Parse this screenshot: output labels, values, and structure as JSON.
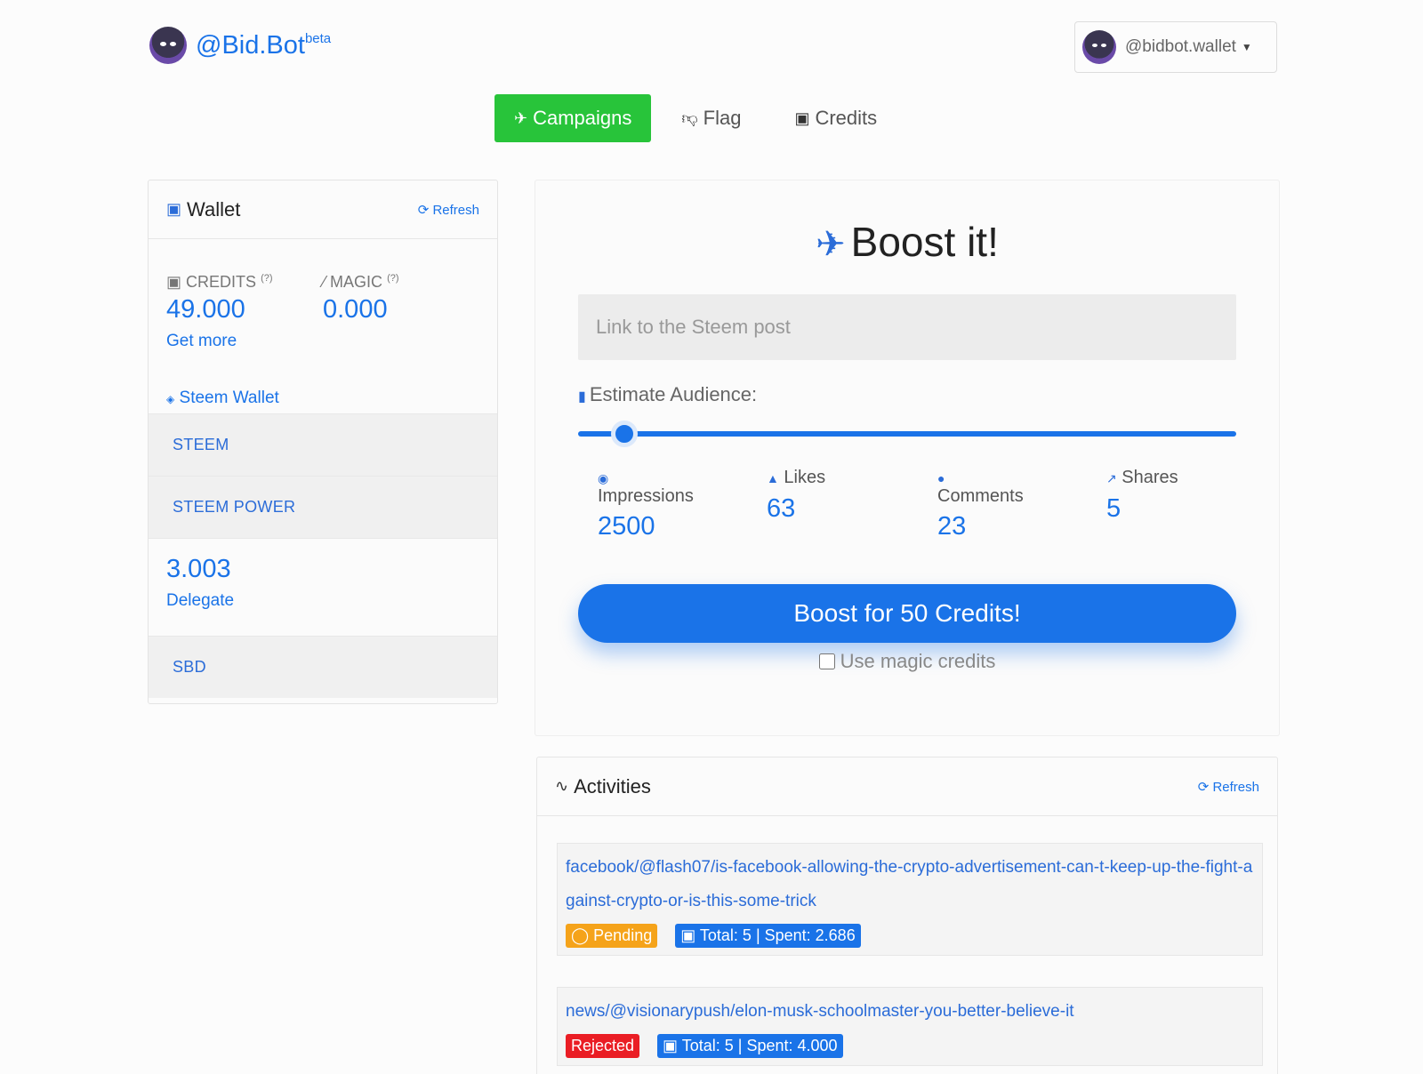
{
  "header": {
    "brand": "@Bid.Bot",
    "brand_sup": "beta",
    "user": "@bidbot.wallet"
  },
  "nav": {
    "campaigns": "Campaigns",
    "flag": "Flag",
    "credits": "Credits"
  },
  "wallet": {
    "title": "Wallet",
    "refresh": "Refresh",
    "credits_label": "CREDITS",
    "credits_help": "(?)",
    "credits_value": "49.000",
    "get_more": "Get more",
    "magic_label": "MAGIC",
    "magic_help": "(?)",
    "magic_value": "0.000",
    "steem_wallet": "Steem Wallet",
    "steem_label": "STEEM",
    "steem_power_label": "STEEM POWER",
    "sp_value": "3.003",
    "delegate": "Delegate",
    "sbd_label": "SBD"
  },
  "boost": {
    "title": "Boost it!",
    "link_placeholder": "Link to the Steem post",
    "estimate_label": "Estimate Audience:",
    "slider_level": 0.07,
    "stats": [
      {
        "label": "Impressions",
        "value": "2500"
      },
      {
        "label": "Likes",
        "value": "63"
      },
      {
        "label": "Comments",
        "value": "23"
      },
      {
        "label": "Shares",
        "value": "5"
      }
    ],
    "button": "Boost for 50 Credits!",
    "magic_checkbox": "Use magic credits"
  },
  "activities": {
    "title": "Activities",
    "refresh": "Refresh",
    "items": [
      {
        "link": "facebook/@flash07/is-facebook-allowing-the-crypto-advertisement-can-t-keep-up-the-fight-against-crypto-or-is-this-some-trick",
        "status": "Pending",
        "totals": "Total: 5 | Spent: 2.686"
      },
      {
        "link": "news/@visionarypush/elon-musk-schoolmaster-you-better-believe-it",
        "status": "Rejected",
        "totals": "Total: 5 | Spent: 4.000"
      }
    ]
  },
  "colors": {
    "accent": "#1a73e8",
    "nav_active": "#28c43a",
    "pending": "#f5a31a",
    "rejected": "#ea1d24"
  }
}
